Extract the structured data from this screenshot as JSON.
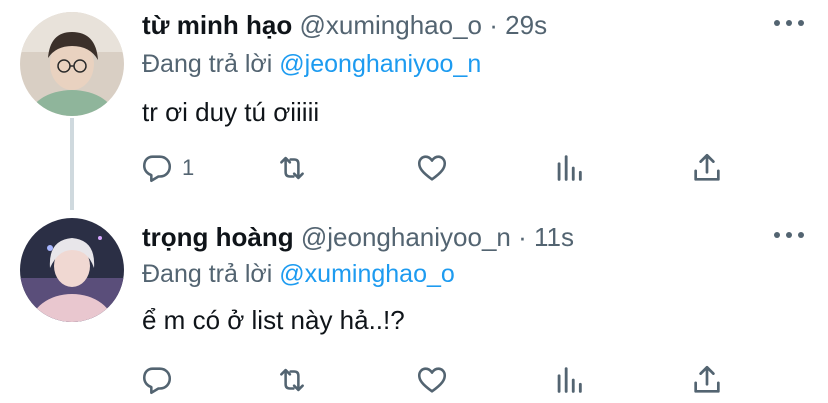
{
  "tweets": [
    {
      "name": "từ minh hạo",
      "handle": "@xuminghao_o",
      "separator": "·",
      "time": "29s",
      "reply_prefix": "Đang trả lời",
      "reply_mention": "@jeonghaniyoo_n",
      "text": "tr ơi duy tú ơiiiii",
      "reply_count": "1",
      "retweet_count": "",
      "like_count": ""
    },
    {
      "name": "trọng hoàng",
      "handle": "@jeonghaniyoo_n",
      "separator": "·",
      "time": "11s",
      "reply_prefix": "Đang trả lời",
      "reply_mention": "@xuminghao_o",
      "text": "ể m có ở list này hả..!?",
      "reply_count": "",
      "retweet_count": "",
      "like_count": ""
    }
  ],
  "icons": {
    "reply": "reply-icon",
    "retweet": "retweet-icon",
    "like": "heart-icon",
    "stats": "stats-icon",
    "share": "share-icon",
    "more": "more-dots-icon"
  },
  "colors": {
    "text": "#0f1419",
    "secondary": "#536471",
    "link": "#1d9bf0",
    "thread_line": "#cfd9de"
  }
}
